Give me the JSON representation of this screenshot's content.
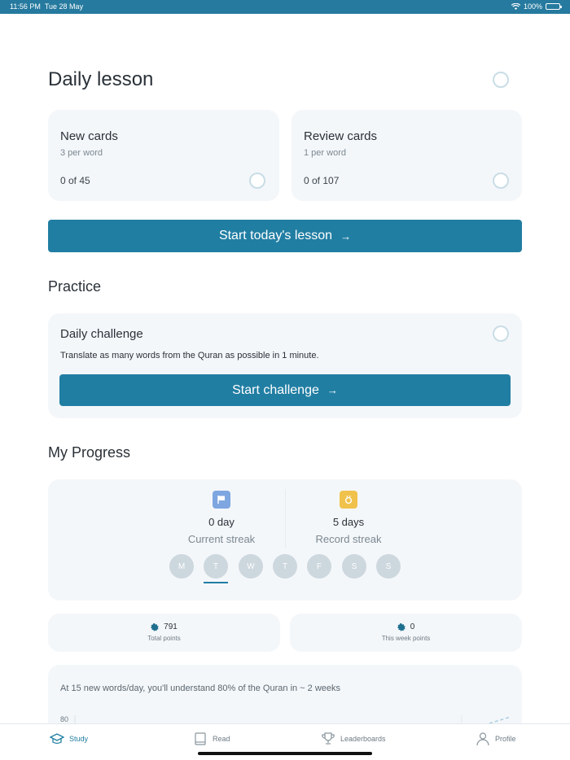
{
  "status": {
    "time": "11:56 PM",
    "date": "Tue 28 May",
    "battery": "100%"
  },
  "daily_lesson": {
    "title": "Daily lesson",
    "new_cards": {
      "title": "New cards",
      "subtitle": "3 per word",
      "count": "0 of 45"
    },
    "review_cards": {
      "title": "Review cards",
      "subtitle": "1 per word",
      "count": "0 of 107"
    },
    "start_label": "Start today's lesson"
  },
  "practice": {
    "title": "Practice",
    "challenge_title": "Daily challenge",
    "challenge_desc": "Translate as many words from the Quran as possible in 1 minute.",
    "challenge_button": "Start challenge"
  },
  "progress": {
    "title": "My Progress",
    "current": {
      "value": "0 day",
      "label": "Current streak",
      "icon": "flag-icon",
      "color": "#7ea6e0"
    },
    "record": {
      "value": "5 days",
      "label": "Record streak",
      "icon": "trophy-icon",
      "color": "#f0c24b"
    },
    "days": [
      "M",
      "T",
      "W",
      "T",
      "F",
      "S",
      "S"
    ],
    "selected_day_index": 1
  },
  "points": {
    "total": {
      "value": "791",
      "label": "Total points"
    },
    "week": {
      "value": "0",
      "label": "This week points"
    }
  },
  "forecast": {
    "text": "At 15 new words/day, you'll understand 80% of the Quran in ~ 2 weeks",
    "axis_top": "80"
  },
  "tabs": [
    {
      "label": "Study",
      "icon": "graduation-cap-icon",
      "active": true
    },
    {
      "label": "Read",
      "icon": "book-icon",
      "active": false
    },
    {
      "label": "Leaderboards",
      "icon": "trophy-icon",
      "active": false
    },
    {
      "label": "Profile",
      "icon": "person-icon",
      "active": false
    }
  ],
  "colors": {
    "accent": "#217ea3",
    "status_bar": "#267a9f",
    "card_bg": "#f4f7fa"
  }
}
